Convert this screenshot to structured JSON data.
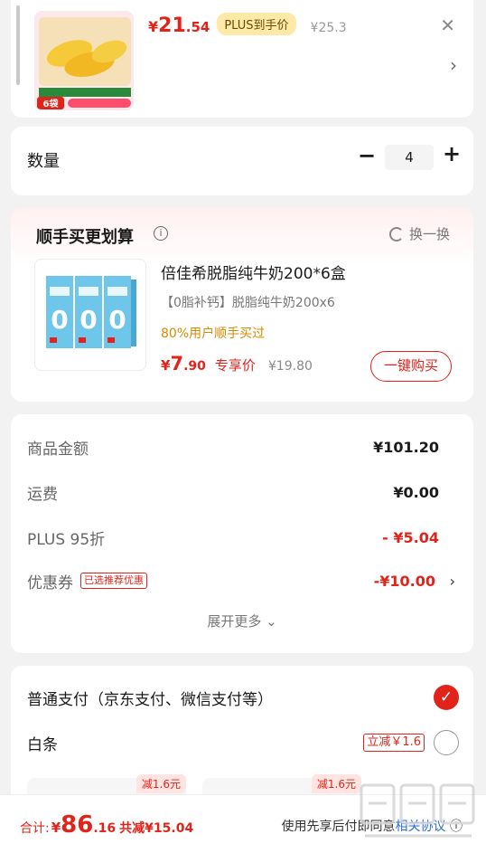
{
  "top_product": {
    "price_symbol": "¥",
    "price_int": "21",
    "price_dec": ".54",
    "plus_badge": "PLUS到手价",
    "original_price": "¥25.3",
    "pack_label": "6袋",
    "close_icon": "close-icon",
    "chevron_icon": "chevron-right-icon"
  },
  "quantity": {
    "label": "数量",
    "value": "4",
    "minus": "−",
    "plus": "+"
  },
  "addon": {
    "title": "顺手买更划算",
    "swap_label": "换一换",
    "product_name": "倍佳希脱脂纯牛奶200*6盒",
    "subtitle": "【0脂补钙】脱脂纯牛奶200x6",
    "stat": "80%用户顺手买过",
    "price_symbol": "¥",
    "price_int": "7",
    "price_dec": ".90",
    "price_tag": "专享价",
    "original_price": "¥19.80",
    "buy_label": "一键购买"
  },
  "summary": {
    "rows": [
      {
        "label": "商品金额",
        "value": "¥101.20"
      },
      {
        "label": "运费",
        "value": "¥0.00"
      },
      {
        "label": "PLUS 95折",
        "value": "- ¥5.04"
      },
      {
        "label": "优惠券",
        "value": "-¥10.00"
      }
    ],
    "coupon_badge": "已选推荐优惠",
    "expand_label": "展开更多"
  },
  "payment": {
    "normal_label": "普通支付（京东支付、微信支付等）",
    "baitiao_label": "白条",
    "baitiao_badge": "立减￥1.6",
    "plan_tags": [
      "减1.6元",
      "减1.6元"
    ]
  },
  "footer": {
    "total_label": "合计:",
    "total_symbol": "¥",
    "total_int": "86",
    "total_dec": ".16",
    "saved": "共减¥15.04",
    "agree_text": "使用先享后付即同意",
    "agree_link": "相关协议"
  },
  "colors": {
    "accent": "#e2231a",
    "plus_gold": "#ffe9a8",
    "link": "#2b6fd6"
  }
}
